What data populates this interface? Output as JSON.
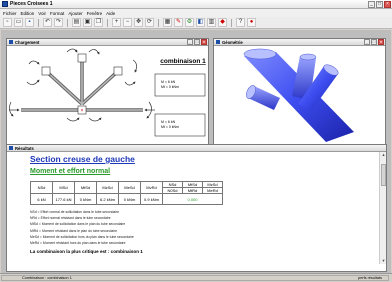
{
  "app": {
    "title": "Pieces Croisees 1"
  },
  "menu": [
    "Fichier",
    "Edition",
    "Voir",
    "Format",
    "Ajouter",
    "Fenêtre",
    "Aide"
  ],
  "toolbar": [
    "new",
    "open",
    "save",
    "undo",
    "redo",
    "print",
    "preview",
    "copy",
    "zoom-in",
    "zoom-out",
    "pan",
    "rotate",
    "grid",
    "calc",
    "options",
    "view1",
    "view2",
    "view3",
    "help",
    "exit"
  ],
  "windows": {
    "chargement": {
      "title": "Chargement"
    },
    "geometrie": {
      "title": "Géométrie"
    },
    "resultats": {
      "title": "Résultats"
    }
  },
  "diagram": {
    "title": "combinaison 1",
    "box1": [
      "M = 6 kN",
      "Mt = 0 kNm"
    ],
    "box2": [
      "M = 6 kN",
      "Mt = 0 kNm"
    ]
  },
  "results": {
    "section_title": "Section creuse de gauche",
    "subtitle": "Moment et effort normal",
    "table_header": [
      "NSd",
      "MSd",
      "MtSd",
      "MzSd",
      "MeSd",
      "MvRd"
    ],
    "table_values": [
      "6 kN",
      "177.6 kN",
      "0 kNm",
      "6.2 kNm",
      "0 kNm",
      "0.9 kNm"
    ],
    "table_extra_header1": [
      "NSd",
      "MtSd",
      "MzSd"
    ],
    "table_extra_header2": [
      "N0Sd",
      "MtRd",
      "MeRd"
    ],
    "table_result": "0.000",
    "legend": [
      "NSd = Effort normal de sollicitation dans le tube secondaire",
      "NRd = Effort normal résistant dans le tube secondaire",
      "MtSd = Moment de sollicitation dans le plan du tube secondaire",
      "MtRd = Moment résistant dans le plan du tube secondaire",
      "MeSd = Moment de sollicitation hors du plan dans le tube secondaire",
      "MeRd = Moment résistant hors du plan dans le tube secondaire"
    ],
    "conclusion": "La combinaison la plus critique est : combinaison 1"
  },
  "status": {
    "left": "Combinaison : combinaison 1",
    "right": "perfs résultats"
  }
}
